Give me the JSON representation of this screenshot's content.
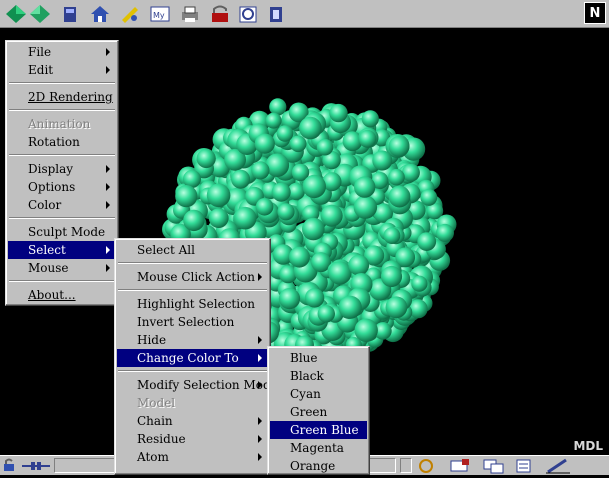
{
  "toolbar": {
    "icons": [
      "back-icon",
      "forward-icon",
      "reload-icon",
      "home-icon",
      "search-icon",
      "my-netscape-icon",
      "print-icon",
      "security-icon",
      "shop-icon",
      "stop-icon"
    ],
    "netscape_logo": "N"
  },
  "viewer": {
    "watermark": "MDL",
    "molecule_color": "#33dd99"
  },
  "main_menu": {
    "items": [
      {
        "label": "File",
        "submenu": true
      },
      {
        "label": "Edit",
        "submenu": true
      },
      {
        "label": "2D Rendering"
      },
      {
        "label": "Animation",
        "disabled": true
      },
      {
        "label": "Rotation"
      },
      {
        "label": "Display",
        "submenu": true
      },
      {
        "label": "Options",
        "submenu": true
      },
      {
        "label": "Color",
        "submenu": true
      },
      {
        "label": "Sculpt Mode"
      },
      {
        "label": "Select",
        "submenu": true,
        "highlighted": true
      },
      {
        "label": "Mouse",
        "submenu": true
      },
      {
        "label": "About..."
      }
    ]
  },
  "select_menu": {
    "items": [
      {
        "label": "Select All"
      },
      {
        "label": "Mouse Click Action",
        "submenu": true
      },
      {
        "label": "Highlight Selection"
      },
      {
        "label": "Invert Selection"
      },
      {
        "label": "Hide",
        "submenu": true
      },
      {
        "label": "Change Color To",
        "submenu": true,
        "highlighted": true
      },
      {
        "label": "Modify Selection Mode",
        "submenu": true
      },
      {
        "label": "Model",
        "disabled": true
      },
      {
        "label": "Chain",
        "submenu": true
      },
      {
        "label": "Residue",
        "submenu": true
      },
      {
        "label": "Atom",
        "submenu": true
      }
    ]
  },
  "color_menu": {
    "items": [
      {
        "label": "Blue"
      },
      {
        "label": "Black"
      },
      {
        "label": "Cyan"
      },
      {
        "label": "Green"
      },
      {
        "label": "Green Blue",
        "highlighted": true
      },
      {
        "label": "Magenta"
      },
      {
        "label": "Orange"
      }
    ]
  },
  "colors": {
    "menu_bg": "#c0c0c0",
    "highlight": "#000080",
    "background": "#000000"
  }
}
